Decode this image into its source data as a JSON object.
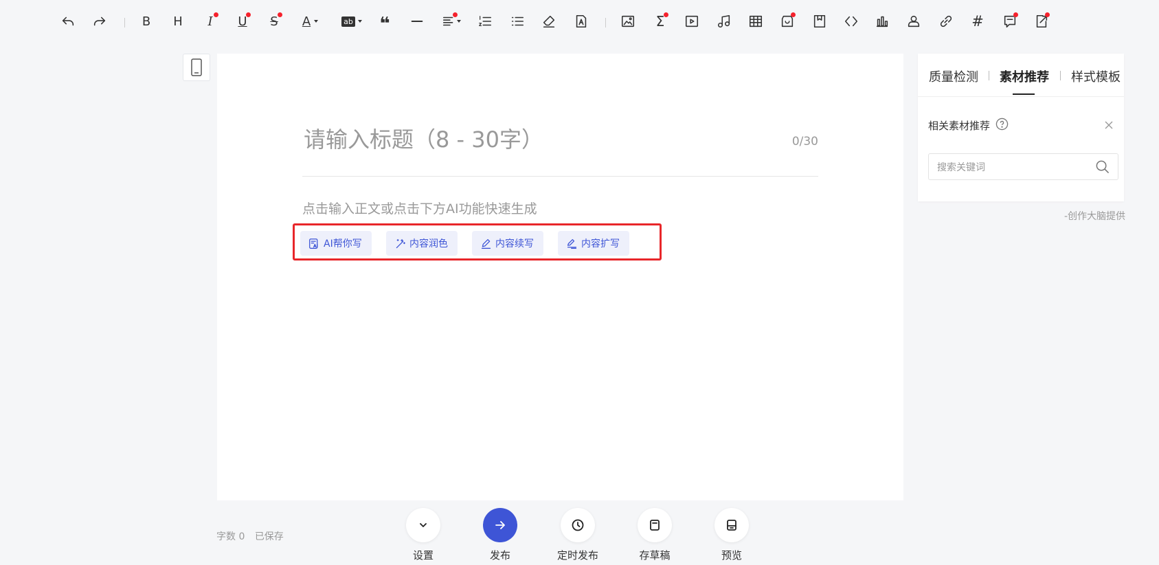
{
  "toolbar": {
    "items": [
      {
        "name": "undo-icon",
        "glyph": "",
        "dot": false,
        "caret": false
      },
      {
        "name": "redo-icon",
        "glyph": "",
        "dot": false,
        "caret": false
      },
      {
        "name": "bold-icon",
        "glyph": "B",
        "dot": false,
        "caret": false
      },
      {
        "name": "heading-icon",
        "glyph": "H",
        "dot": false,
        "caret": false
      },
      {
        "name": "italic-icon",
        "glyph": "I",
        "dot": true,
        "caret": false
      },
      {
        "name": "underline-icon",
        "glyph": "U",
        "dot": true,
        "caret": false
      },
      {
        "name": "strikethrough-icon",
        "glyph": "S",
        "dot": true,
        "caret": false
      },
      {
        "name": "font-color-icon",
        "glyph": "A",
        "dot": false,
        "caret": true
      },
      {
        "name": "highlight-icon",
        "glyph": "ab",
        "dot": false,
        "caret": true
      },
      {
        "name": "quote-icon",
        "glyph": "❝",
        "dot": false,
        "caret": false
      },
      {
        "name": "divider-icon",
        "glyph": "",
        "dot": false,
        "caret": false
      },
      {
        "name": "align-icon",
        "glyph": "",
        "dot": true,
        "caret": true
      },
      {
        "name": "ordered-list-icon",
        "glyph": "",
        "dot": false,
        "caret": false
      },
      {
        "name": "unordered-list-icon",
        "glyph": "",
        "dot": false,
        "caret": false
      },
      {
        "name": "eraser-icon",
        "glyph": "",
        "dot": false,
        "caret": false
      },
      {
        "name": "format-painter-icon",
        "glyph": "",
        "dot": false,
        "caret": false
      },
      {
        "name": "image-icon",
        "glyph": "",
        "dot": false,
        "caret": false
      },
      {
        "name": "formula-icon",
        "glyph": "Σ",
        "dot": true,
        "caret": false
      },
      {
        "name": "video-icon",
        "glyph": "",
        "dot": false,
        "caret": false
      },
      {
        "name": "music-icon",
        "glyph": "♫",
        "dot": false,
        "caret": false
      },
      {
        "name": "table-icon",
        "glyph": "",
        "dot": false,
        "caret": false
      },
      {
        "name": "shop-icon",
        "glyph": "",
        "dot": true,
        "caret": false
      },
      {
        "name": "bookmark-icon",
        "glyph": "",
        "dot": false,
        "caret": false
      },
      {
        "name": "code-icon",
        "glyph": "",
        "dot": false,
        "caret": false
      },
      {
        "name": "chart-icon",
        "glyph": "",
        "dot": false,
        "caret": false
      },
      {
        "name": "person-icon",
        "glyph": "",
        "dot": false,
        "caret": false
      },
      {
        "name": "link-icon",
        "glyph": "",
        "dot": false,
        "caret": false
      },
      {
        "name": "hashtag-icon",
        "glyph": "#",
        "dot": false,
        "caret": false
      },
      {
        "name": "comment-icon",
        "glyph": "",
        "dot": true,
        "caret": false
      },
      {
        "name": "export-icon",
        "glyph": "",
        "dot": true,
        "caret": false
      }
    ]
  },
  "editor": {
    "title_placeholder": "请输入标题（8 - 30字）",
    "title_count": "0/30",
    "body_hint": "点击输入正文或点击下方AI功能快速生成",
    "ai_buttons": [
      {
        "label": "AI帮你写",
        "icon": "ai-write-icon"
      },
      {
        "label": "内容润色",
        "icon": "magic-wand-icon"
      },
      {
        "label": "内容续写",
        "icon": "pen-icon"
      },
      {
        "label": "内容扩写",
        "icon": "pen-lines-icon"
      }
    ]
  },
  "panel": {
    "tabs": [
      "质量检测",
      "素材推荐",
      "样式模板"
    ],
    "active_tab": "素材推荐",
    "related_label": "相关素材推荐",
    "search_placeholder": "搜索关键词",
    "credit": "-创作大脑提供"
  },
  "footer": {
    "word_count": "字数 0",
    "save_status": "已保存",
    "actions": [
      {
        "label": "设置",
        "icon": "chevron-down-icon"
      },
      {
        "label": "发布",
        "icon": "arrow-right-icon"
      },
      {
        "label": "定时发布",
        "icon": "clock-icon"
      },
      {
        "label": "存草稿",
        "icon": "draft-icon"
      },
      {
        "label": "预览",
        "icon": "preview-icon"
      }
    ]
  },
  "colors": {
    "accent": "#3e55d6",
    "highlight_border": "#e8262a",
    "dot": "#f5222d"
  }
}
